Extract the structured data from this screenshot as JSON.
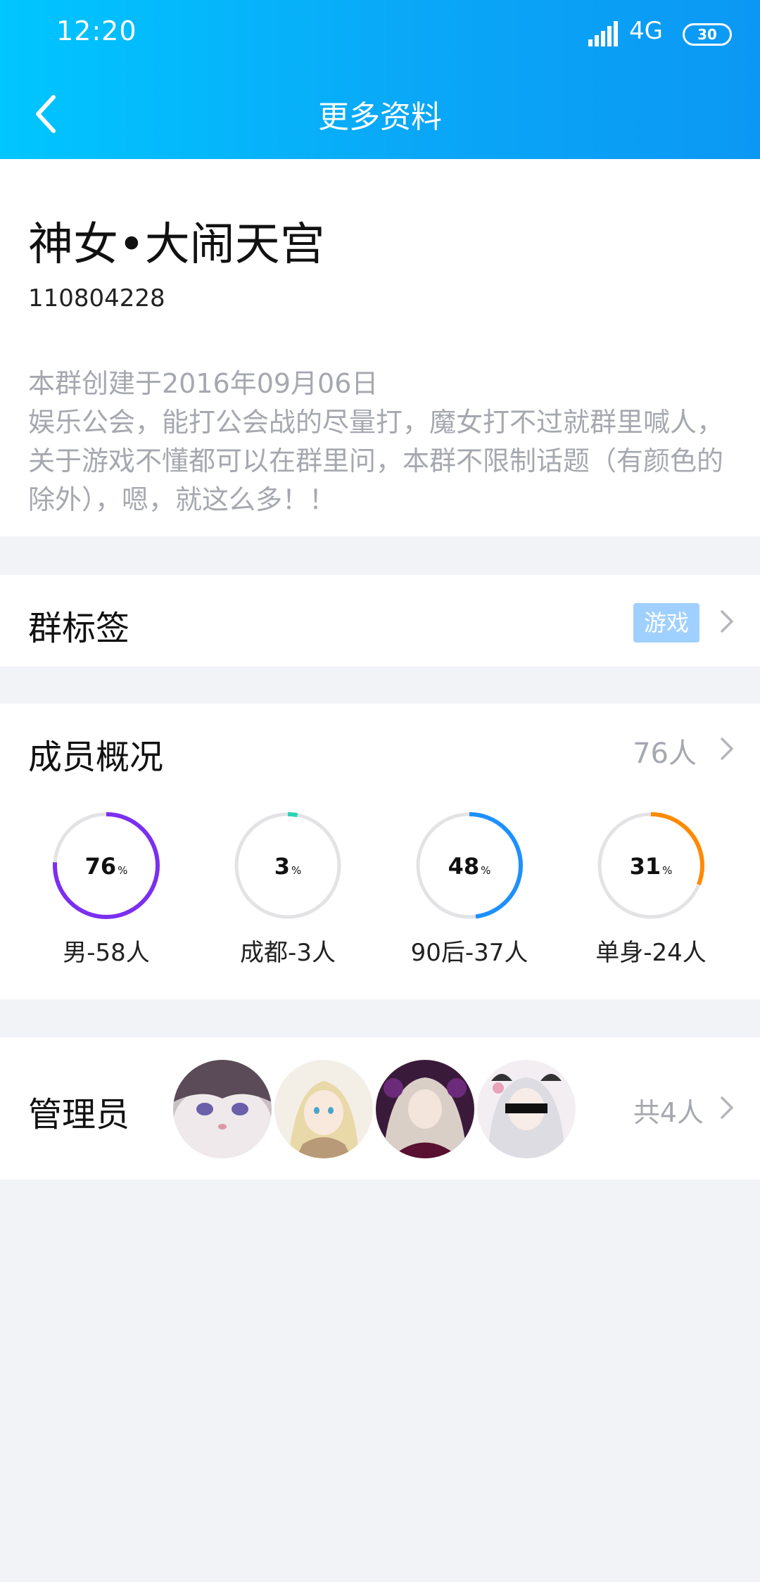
{
  "status": {
    "time": "12:20",
    "network": "4G",
    "battery": "30"
  },
  "nav": {
    "title": "更多资料"
  },
  "group": {
    "name": "神女•大闹天宫",
    "id": "110804228",
    "created": "本群创建于2016年09月06日",
    "intro": "娱乐公会，能打公会战的尽量打，魔女打不过就群里喊人，关于游戏不懂都可以在群里问，本群不限制话题（有颜色的除外），嗯，就这么多！！"
  },
  "tags": {
    "label": "群标签",
    "tag": "游戏"
  },
  "members": {
    "label": "成员概况",
    "count": "76人",
    "stats": [
      {
        "value": "76",
        "unit": "%",
        "caption": "男-58人",
        "percent": 76,
        "color": "#7b2ff0"
      },
      {
        "value": "3",
        "unit": "%",
        "caption": "成都-3人",
        "percent": 3,
        "color": "#2bd4b8"
      },
      {
        "value": "48",
        "unit": "%",
        "caption": "90后-37人",
        "percent": 48,
        "color": "#1e90ff"
      },
      {
        "value": "31",
        "unit": "%",
        "caption": "单身-24人",
        "percent": 31,
        "color": "#ff8a00"
      }
    ]
  },
  "admins": {
    "label": "管理员",
    "total": "共4人"
  }
}
